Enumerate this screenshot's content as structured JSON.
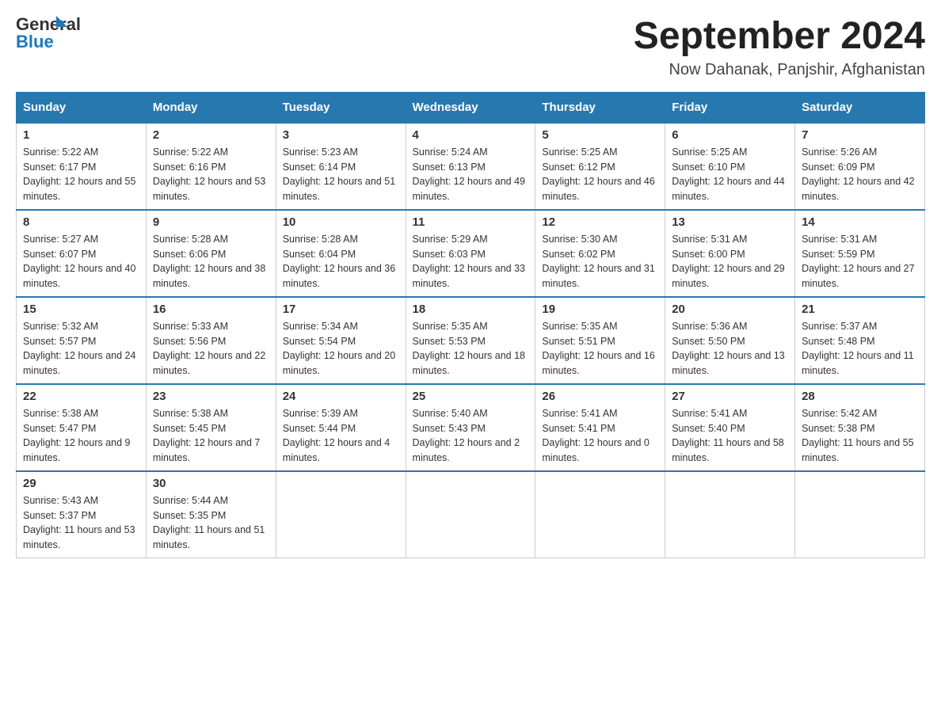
{
  "header": {
    "title": "September 2024",
    "subtitle": "Now Dahanak, Panjshir, Afghanistan"
  },
  "logo": {
    "line1": "General",
    "line2": "Blue"
  },
  "days_of_week": [
    "Sunday",
    "Monday",
    "Tuesday",
    "Wednesday",
    "Thursday",
    "Friday",
    "Saturday"
  ],
  "weeks": [
    [
      {
        "day": "1",
        "sunrise": "Sunrise: 5:22 AM",
        "sunset": "Sunset: 6:17 PM",
        "daylight": "Daylight: 12 hours and 55 minutes."
      },
      {
        "day": "2",
        "sunrise": "Sunrise: 5:22 AM",
        "sunset": "Sunset: 6:16 PM",
        "daylight": "Daylight: 12 hours and 53 minutes."
      },
      {
        "day": "3",
        "sunrise": "Sunrise: 5:23 AM",
        "sunset": "Sunset: 6:14 PM",
        "daylight": "Daylight: 12 hours and 51 minutes."
      },
      {
        "day": "4",
        "sunrise": "Sunrise: 5:24 AM",
        "sunset": "Sunset: 6:13 PM",
        "daylight": "Daylight: 12 hours and 49 minutes."
      },
      {
        "day": "5",
        "sunrise": "Sunrise: 5:25 AM",
        "sunset": "Sunset: 6:12 PM",
        "daylight": "Daylight: 12 hours and 46 minutes."
      },
      {
        "day": "6",
        "sunrise": "Sunrise: 5:25 AM",
        "sunset": "Sunset: 6:10 PM",
        "daylight": "Daylight: 12 hours and 44 minutes."
      },
      {
        "day": "7",
        "sunrise": "Sunrise: 5:26 AM",
        "sunset": "Sunset: 6:09 PM",
        "daylight": "Daylight: 12 hours and 42 minutes."
      }
    ],
    [
      {
        "day": "8",
        "sunrise": "Sunrise: 5:27 AM",
        "sunset": "Sunset: 6:07 PM",
        "daylight": "Daylight: 12 hours and 40 minutes."
      },
      {
        "day": "9",
        "sunrise": "Sunrise: 5:28 AM",
        "sunset": "Sunset: 6:06 PM",
        "daylight": "Daylight: 12 hours and 38 minutes."
      },
      {
        "day": "10",
        "sunrise": "Sunrise: 5:28 AM",
        "sunset": "Sunset: 6:04 PM",
        "daylight": "Daylight: 12 hours and 36 minutes."
      },
      {
        "day": "11",
        "sunrise": "Sunrise: 5:29 AM",
        "sunset": "Sunset: 6:03 PM",
        "daylight": "Daylight: 12 hours and 33 minutes."
      },
      {
        "day": "12",
        "sunrise": "Sunrise: 5:30 AM",
        "sunset": "Sunset: 6:02 PM",
        "daylight": "Daylight: 12 hours and 31 minutes."
      },
      {
        "day": "13",
        "sunrise": "Sunrise: 5:31 AM",
        "sunset": "Sunset: 6:00 PM",
        "daylight": "Daylight: 12 hours and 29 minutes."
      },
      {
        "day": "14",
        "sunrise": "Sunrise: 5:31 AM",
        "sunset": "Sunset: 5:59 PM",
        "daylight": "Daylight: 12 hours and 27 minutes."
      }
    ],
    [
      {
        "day": "15",
        "sunrise": "Sunrise: 5:32 AM",
        "sunset": "Sunset: 5:57 PM",
        "daylight": "Daylight: 12 hours and 24 minutes."
      },
      {
        "day": "16",
        "sunrise": "Sunrise: 5:33 AM",
        "sunset": "Sunset: 5:56 PM",
        "daylight": "Daylight: 12 hours and 22 minutes."
      },
      {
        "day": "17",
        "sunrise": "Sunrise: 5:34 AM",
        "sunset": "Sunset: 5:54 PM",
        "daylight": "Daylight: 12 hours and 20 minutes."
      },
      {
        "day": "18",
        "sunrise": "Sunrise: 5:35 AM",
        "sunset": "Sunset: 5:53 PM",
        "daylight": "Daylight: 12 hours and 18 minutes."
      },
      {
        "day": "19",
        "sunrise": "Sunrise: 5:35 AM",
        "sunset": "Sunset: 5:51 PM",
        "daylight": "Daylight: 12 hours and 16 minutes."
      },
      {
        "day": "20",
        "sunrise": "Sunrise: 5:36 AM",
        "sunset": "Sunset: 5:50 PM",
        "daylight": "Daylight: 12 hours and 13 minutes."
      },
      {
        "day": "21",
        "sunrise": "Sunrise: 5:37 AM",
        "sunset": "Sunset: 5:48 PM",
        "daylight": "Daylight: 12 hours and 11 minutes."
      }
    ],
    [
      {
        "day": "22",
        "sunrise": "Sunrise: 5:38 AM",
        "sunset": "Sunset: 5:47 PM",
        "daylight": "Daylight: 12 hours and 9 minutes."
      },
      {
        "day": "23",
        "sunrise": "Sunrise: 5:38 AM",
        "sunset": "Sunset: 5:45 PM",
        "daylight": "Daylight: 12 hours and 7 minutes."
      },
      {
        "day": "24",
        "sunrise": "Sunrise: 5:39 AM",
        "sunset": "Sunset: 5:44 PM",
        "daylight": "Daylight: 12 hours and 4 minutes."
      },
      {
        "day": "25",
        "sunrise": "Sunrise: 5:40 AM",
        "sunset": "Sunset: 5:43 PM",
        "daylight": "Daylight: 12 hours and 2 minutes."
      },
      {
        "day": "26",
        "sunrise": "Sunrise: 5:41 AM",
        "sunset": "Sunset: 5:41 PM",
        "daylight": "Daylight: 12 hours and 0 minutes."
      },
      {
        "day": "27",
        "sunrise": "Sunrise: 5:41 AM",
        "sunset": "Sunset: 5:40 PM",
        "daylight": "Daylight: 11 hours and 58 minutes."
      },
      {
        "day": "28",
        "sunrise": "Sunrise: 5:42 AM",
        "sunset": "Sunset: 5:38 PM",
        "daylight": "Daylight: 11 hours and 55 minutes."
      }
    ],
    [
      {
        "day": "29",
        "sunrise": "Sunrise: 5:43 AM",
        "sunset": "Sunset: 5:37 PM",
        "daylight": "Daylight: 11 hours and 53 minutes."
      },
      {
        "day": "30",
        "sunrise": "Sunrise: 5:44 AM",
        "sunset": "Sunset: 5:35 PM",
        "daylight": "Daylight: 11 hours and 51 minutes."
      },
      null,
      null,
      null,
      null,
      null
    ]
  ]
}
